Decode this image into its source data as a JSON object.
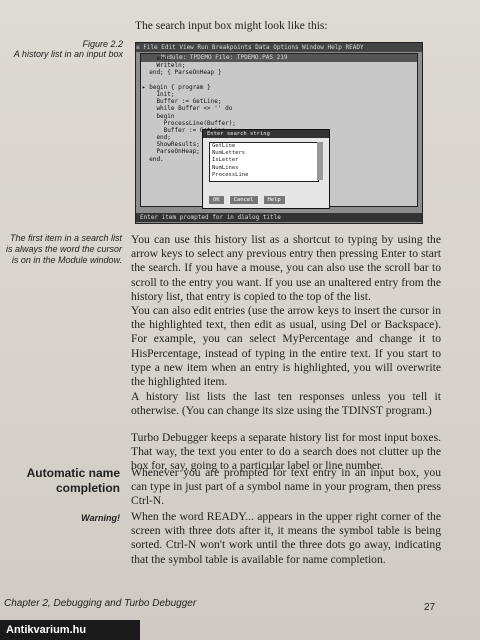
{
  "intro": "The search input box might look like this:",
  "figure": {
    "number": "Figure 2.2",
    "caption": "A history list in an input box"
  },
  "screen": {
    "menubar": "≡  File  Edit  View  Run  Breakpoints  Data  Options  Window  Help         READY",
    "window_title": "Module: TPDEMO  File: TPDEMO.PAS 219",
    "code_lines": [
      "    end;",
      "    Writeln;",
      "  end; { ParseOnHeap }",
      "",
      "▸ begin { program }",
      "    Init;",
      "    Buffer := GetLine;",
      "    while Buffer <> '' do",
      "    begin",
      "      ProcessLine(Buffer);",
      "      Buffer := GetLine;",
      "    end;",
      "    ShowResults;",
      "    ParseOnHeap;",
      "  end."
    ],
    "dialog_title": "Enter search string",
    "history": [
      "GetLine",
      "NumLetters",
      "IsLetter",
      "NumLines",
      "ProcessLine"
    ],
    "buttons": [
      "OK",
      "Cancel",
      "Help"
    ],
    "status": "Enter item prompted for in dialog title"
  },
  "margin_note": "The first item in a search list is always the word the cursor is on in the Module window.",
  "paragraphs": {
    "p1": "You can use this history list as a shortcut to typing by using the arrow keys to select any previous entry then pressing Enter to start the search. If you have a mouse, you can also use the scroll bar to scroll to the entry you want. If you use an unaltered entry from the history list, that entry is copied to the top of the list.",
    "p2": "You can also edit entries (use the arrow keys to insert the cursor in the highlighted text, then edit as usual, using Del or Backspace). For example, you can select MyPercentage and change it to HisPercentage, instead of typing in the entire text. If you start to type a new item when an entry is highlighted, you will overwrite the highlighted item.",
    "p3": "A history list lists the last ten responses unless you tell it otherwise. (You can change its size using the TDINST program.)",
    "p4": "Turbo Debugger keeps a separate history list for most input boxes. That way, the text you enter to do a search does not clutter up the box for, say, going to a particular label or line number.",
    "p5": "Whenever you are prompted for text entry in an input box, you can type in just part of a symbol name in your program, then press Ctrl-N.",
    "p6": "When the word READY... appears in the upper right corner of the screen with three dots after it, it means the symbol table is being sorted. Ctrl-N won't work until the three dots go away, indicating that the symbol table is available for name completion."
  },
  "heading": {
    "line1": "Automatic name",
    "line2": "completion"
  },
  "warning_label": "Warning!",
  "footer": "Chapter 2, Debugging and Turbo Debugger",
  "page_number": "27",
  "watermark": "Antikvarium.hu"
}
